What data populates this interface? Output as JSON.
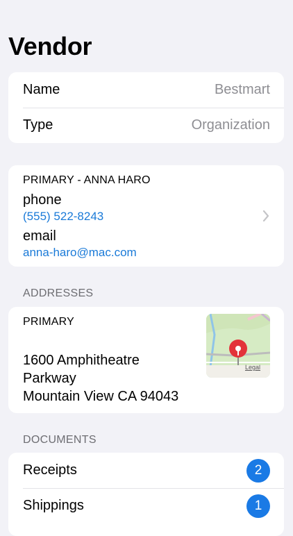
{
  "title": "Vendor",
  "info": {
    "name_label": "Name",
    "name_value": "Bestmart",
    "type_label": "Type",
    "type_value": "Organization"
  },
  "contact": {
    "header": "PRIMARY - ANNA HARO",
    "phone_label": "phone",
    "phone_value": "(555) 522-8243",
    "email_label": "email",
    "email_value": "anna-haro@mac.com"
  },
  "addresses": {
    "section_title": "ADDRESSES",
    "label": "PRIMARY",
    "line1": "1600 Amphitheatre",
    "line2": "Parkway",
    "line3": "Mountain View CA 94043",
    "map_legal": "Legal"
  },
  "documents": {
    "section_title": "DOCUMENTS",
    "items": [
      {
        "label": "Receipts",
        "count": "2"
      },
      {
        "label": "Shippings",
        "count": "1"
      }
    ]
  },
  "colors": {
    "accent": "#1a7ad8",
    "badge": "#1a7ae5",
    "background": "#f2f2f7"
  }
}
